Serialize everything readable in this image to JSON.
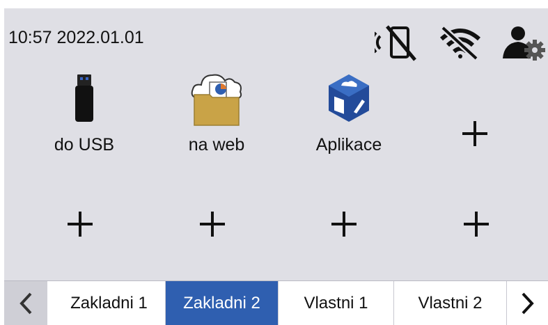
{
  "status": {
    "datetime": "10:57 2022.01.01",
    "icons": [
      "nfc-disabled-icon",
      "wifi-off-icon",
      "user-settings-icon"
    ]
  },
  "tiles": [
    {
      "label": "do USB",
      "icon": "usb-drive-icon"
    },
    {
      "label": "na web",
      "icon": "cloud-folder-icon"
    },
    {
      "label": "Aplikace",
      "icon": "apps-cube-icon"
    }
  ],
  "add_slots": 5,
  "tabs": [
    {
      "label": "Zakladni 1",
      "active": false
    },
    {
      "label": "Zakladni 2",
      "active": true
    },
    {
      "label": "Vlastni 1",
      "active": false
    },
    {
      "label": "Vlastni 2",
      "active": false
    }
  ],
  "colors": {
    "background": "#dfdfe5",
    "active_tab": "#2f5fb0",
    "folder": "#c9a347",
    "app_cube": "#234b9a"
  }
}
